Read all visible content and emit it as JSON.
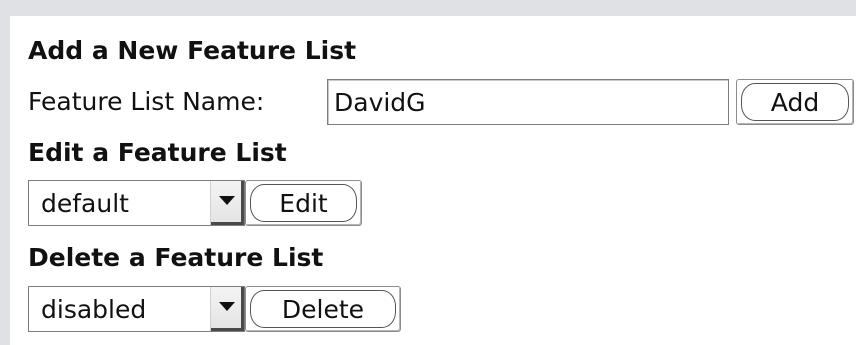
{
  "add_section": {
    "heading": "Add a New Feature List",
    "name_label": "Feature List Name:",
    "name_value": "DavidG",
    "add_button": "Add"
  },
  "edit_section": {
    "heading": "Edit a Feature List",
    "selected_list": "default",
    "edit_button": "Edit"
  },
  "delete_section": {
    "heading": "Delete a Feature List",
    "selected_list": "disabled",
    "delete_button": "Delete"
  },
  "icons": {
    "dropdown": "chevron-down-icon"
  }
}
